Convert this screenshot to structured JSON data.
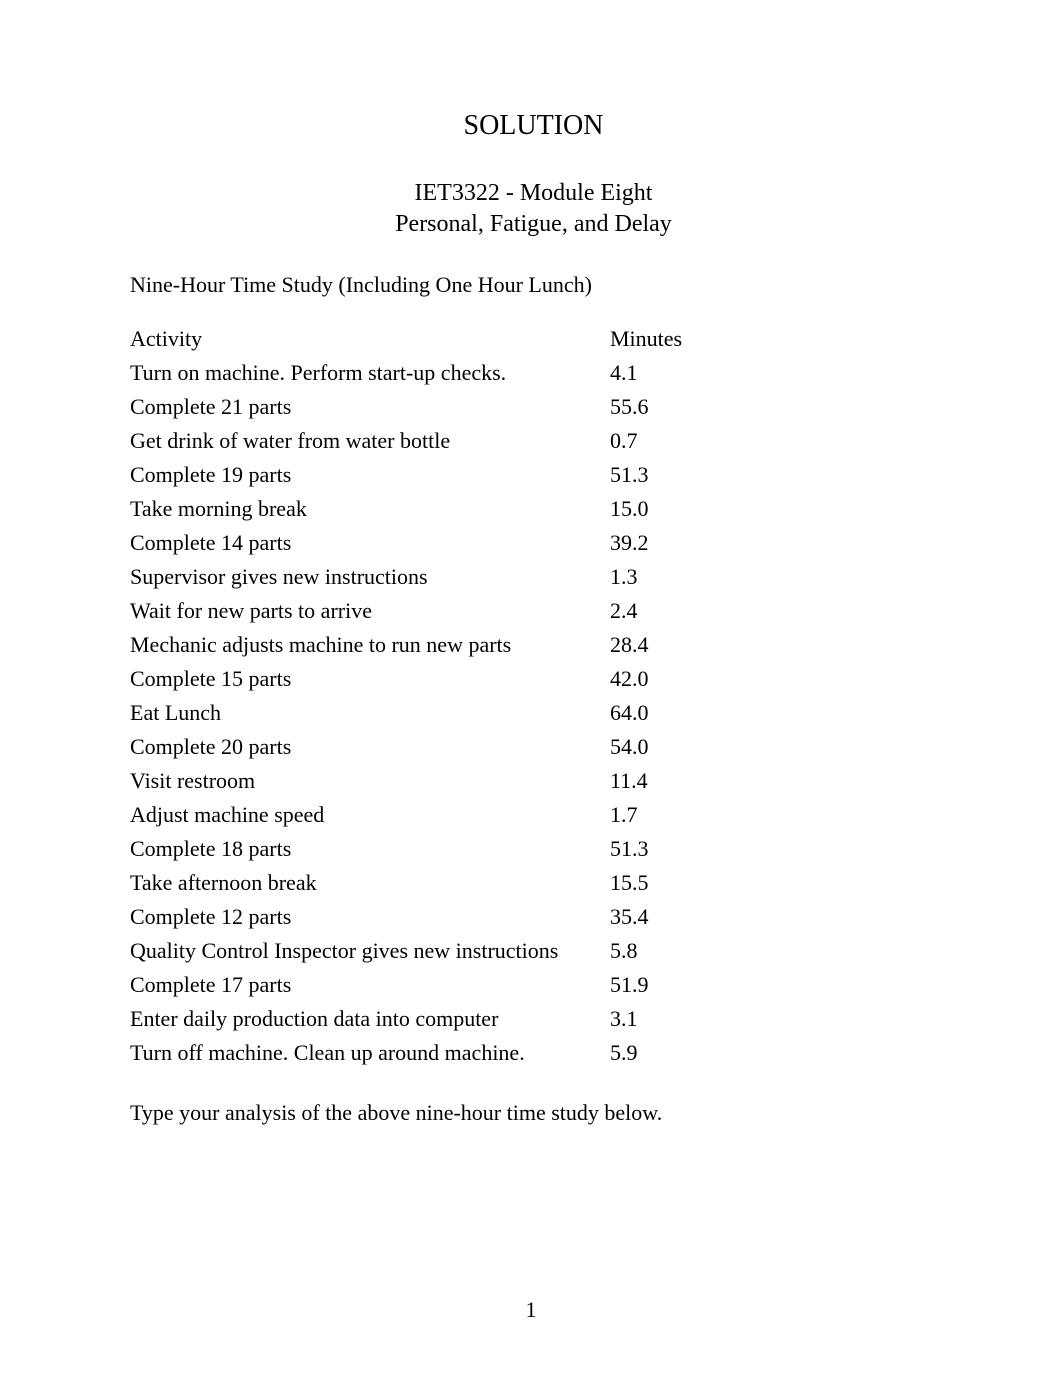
{
  "header": {
    "solution_label": "SOLUTION",
    "course_line": "IET3322 - Module Eight",
    "subtitle_line": "Personal, Fatigue, and Delay"
  },
  "section": {
    "heading": "Nine-Hour Time Study (Including One Hour Lunch)"
  },
  "table": {
    "headers": {
      "activity": "Activity",
      "minutes": "Minutes"
    },
    "rows": [
      {
        "activity": "Turn on machine. Perform start-up checks.",
        "minutes": "4.1"
      },
      {
        "activity": "Complete 21 parts",
        "minutes": "55.6"
      },
      {
        "activity": "Get drink of water from water bottle",
        "minutes": "0.7"
      },
      {
        "activity": "Complete 19 parts",
        "minutes": "51.3"
      },
      {
        "activity": "Take morning break",
        "minutes": "15.0"
      },
      {
        "activity": "Complete 14 parts",
        "minutes": "39.2"
      },
      {
        "activity": "Supervisor gives new instructions",
        "minutes": "1.3"
      },
      {
        "activity": "Wait for new parts to arrive",
        "minutes": "2.4"
      },
      {
        "activity": "Mechanic adjusts machine to run new parts",
        "minutes": "28.4"
      },
      {
        "activity": "Complete 15 parts",
        "minutes": "42.0"
      },
      {
        "activity": "Eat Lunch",
        "minutes": "64.0"
      },
      {
        "activity": "Complete 20 parts",
        "minutes": "54.0"
      },
      {
        "activity": "Visit restroom",
        "minutes": "11.4"
      },
      {
        "activity": "Adjust machine speed",
        "minutes": "1.7"
      },
      {
        "activity": "Complete 18 parts",
        "minutes": "51.3"
      },
      {
        "activity": "Take afternoon break",
        "minutes": "15.5"
      },
      {
        "activity": "Complete 12 parts",
        "minutes": "35.4"
      },
      {
        "activity": "Quality Control Inspector gives new instructions",
        "minutes": "5.8"
      },
      {
        "activity": "Complete 17 parts",
        "minutes": "51.9"
      },
      {
        "activity": "Enter daily production data into computer",
        "minutes": "3.1"
      },
      {
        "activity": "Turn off machine. Clean up around machine.",
        "minutes": "5.9"
      }
    ]
  },
  "instruction": "Type your analysis of the above nine-hour time study below.",
  "page_number": "1"
}
